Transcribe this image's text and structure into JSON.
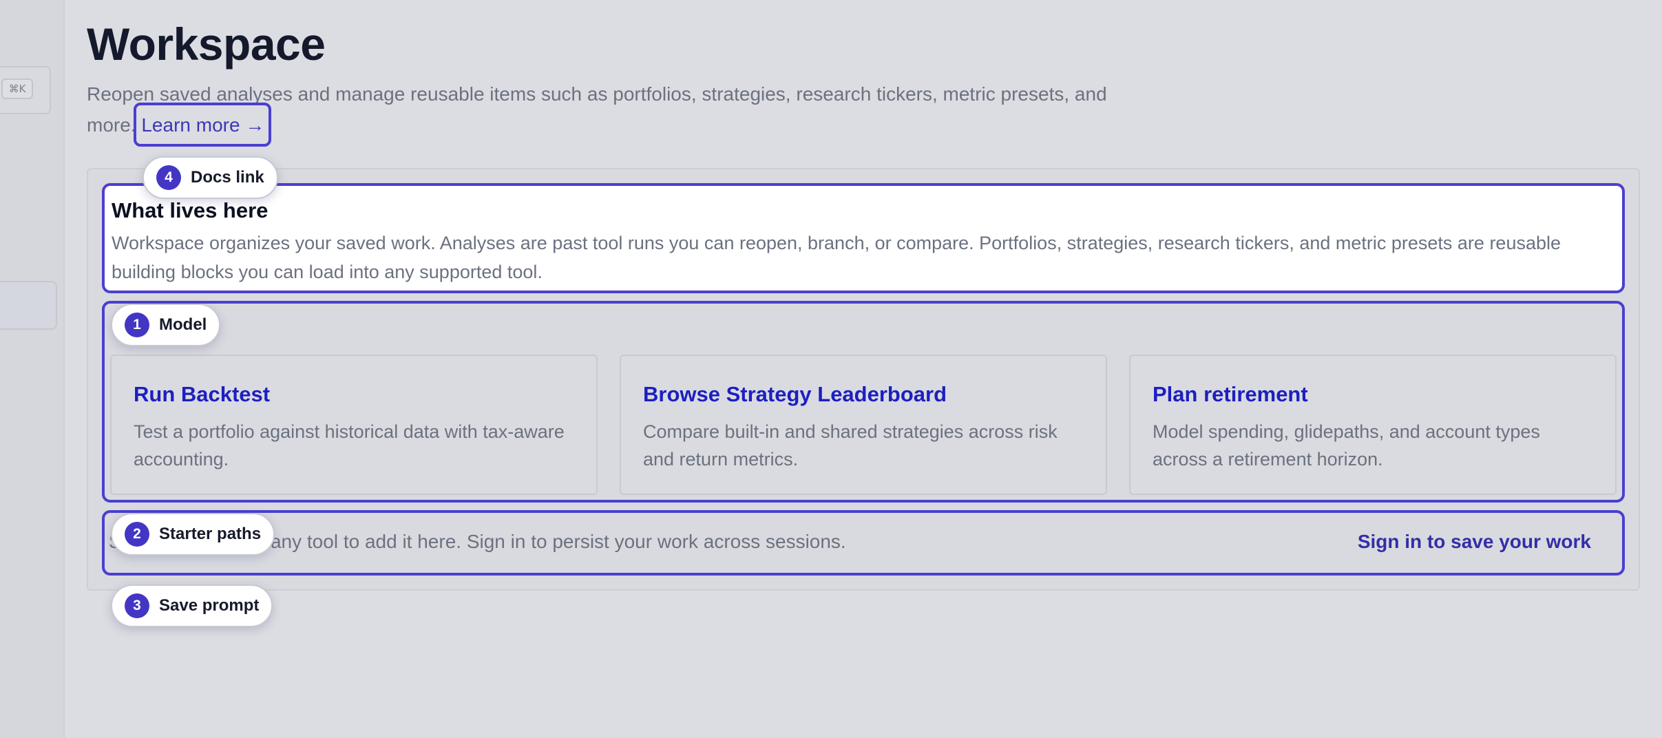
{
  "sidebar": {
    "search_shortcut": "⌘K"
  },
  "header": {
    "title": "Workspace",
    "description": "Reopen saved analyses and manage reusable items such as portfolios, strategies, research tickers, metric presets, and more.",
    "learn_more": "Learn more →"
  },
  "info": {
    "title": "What lives here",
    "text": "Workspace organizes your saved work. Analyses are past tool runs you can reopen, branch, or compare. Portfolios, strategies, research tickers, and metric presets are reusable building blocks you can load into any supported tool."
  },
  "starter_cards": [
    {
      "title": "Run Backtest",
      "description": "Test a portfolio against historical data with tax-aware accounting."
    },
    {
      "title": "Browse Strategy Leaderboard",
      "description": "Compare built-in and shared strategies across risk and return metrics."
    },
    {
      "title": "Plan retirement",
      "description": "Model spending, glidepaths, and account types across a retirement horizon."
    }
  ],
  "save_prompt": {
    "text": "Save a result from any tool to add it here. Sign in to persist your work across sessions.",
    "sign_in": "Sign in to save your work"
  },
  "tour": [
    {
      "number": "1",
      "label": "Model"
    },
    {
      "number": "2",
      "label": "Starter paths"
    },
    {
      "number": "3",
      "label": "Save prompt"
    },
    {
      "number": "4",
      "label": "Docs link"
    }
  ],
  "colors": {
    "accent": "#4a3fd0",
    "link": "#1c1fbf",
    "background": "#dcdde2"
  }
}
